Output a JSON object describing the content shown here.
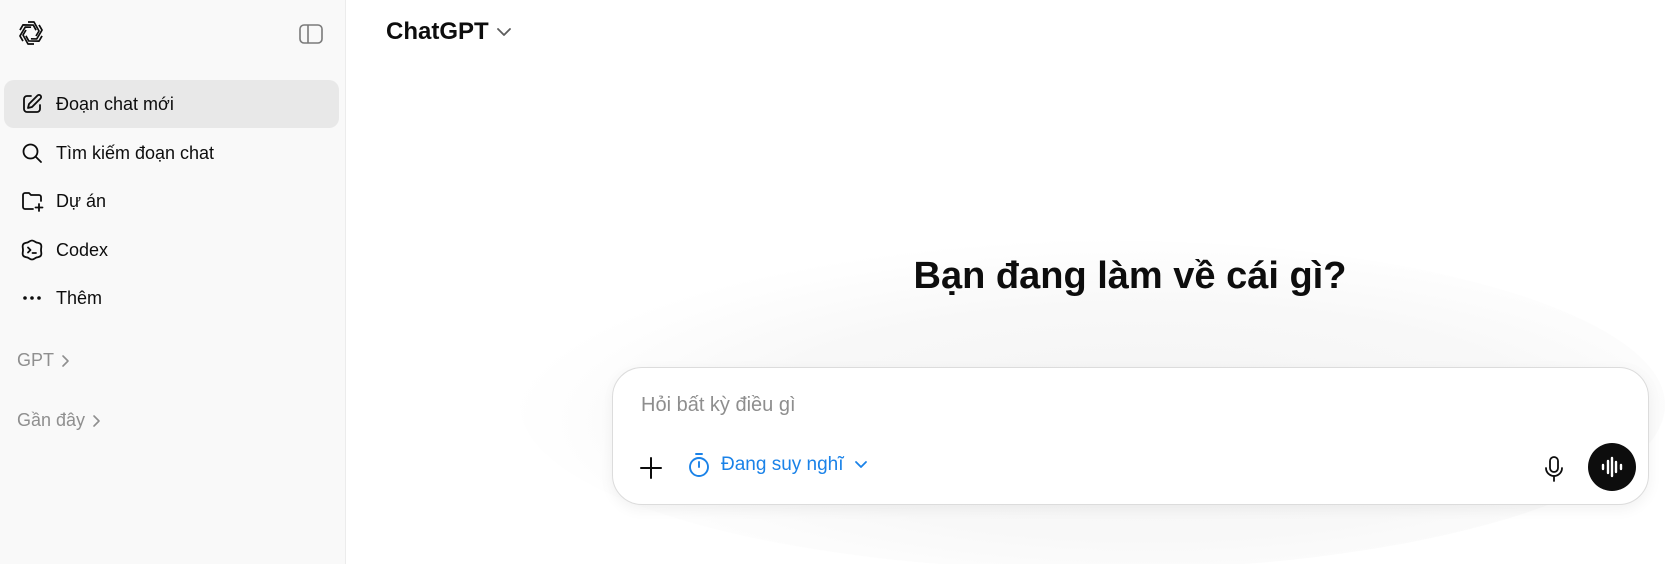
{
  "app": {
    "model_name": "ChatGPT"
  },
  "sidebar": {
    "items": [
      {
        "label": "Đoạn chat mới",
        "icon": "new-chat-icon",
        "active": true
      },
      {
        "label": "Tìm kiếm đoạn chat",
        "icon": "search-icon"
      },
      {
        "label": "Dự án",
        "icon": "folder-add-icon"
      },
      {
        "label": "Codex",
        "icon": "codex-icon"
      },
      {
        "label": "Thêm",
        "icon": "more-icon"
      }
    ],
    "sections": [
      {
        "label": "GPT"
      },
      {
        "label": "Gần đây"
      }
    ]
  },
  "main": {
    "headline": "Bạn đang làm về cái gì?",
    "composer": {
      "placeholder": "Hỏi bất kỳ điều gì",
      "value": "",
      "mode_label": "Đang suy nghĩ"
    }
  },
  "colors": {
    "accent": "#1a82e8",
    "sidebar_bg": "#f9f9f9",
    "active_item": "#e8e8e8",
    "text": "#0d0d0d",
    "muted": "#8f8f8f"
  }
}
